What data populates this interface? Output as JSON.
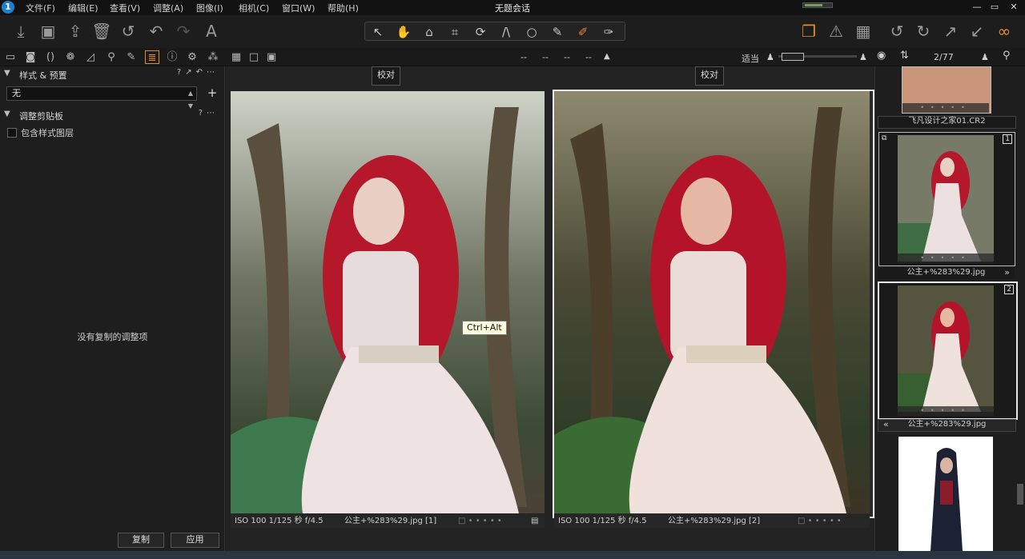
{
  "window": {
    "title": "无题会话",
    "logo": "1",
    "menu": [
      "文件(F)",
      "编辑(E)",
      "查看(V)",
      "调整(A)",
      "图像(I)",
      "相机(C)",
      "窗口(W)",
      "帮助(H)"
    ],
    "controls": [
      "—",
      "▭",
      "✕"
    ]
  },
  "toolbar": {
    "left_icons": [
      "import-icon",
      "camera-icon",
      "export-icon",
      "trash-icon",
      "undo-all-icon",
      "undo-icon",
      "redo-icon",
      "text-icon"
    ],
    "cursor_tools": [
      "select-icon",
      "pan-icon",
      "loupe-icon",
      "crop-icon",
      "rotate-icon",
      "keystone-icon",
      "circle-icon",
      "brush-icon",
      "erase-icon",
      "pick-icon"
    ],
    "right_icons": [
      "layers-icon",
      "warning-icon",
      "grid-icon",
      "rotate-left-icon",
      "rotate-right-icon",
      "arrow-up-right-icon",
      "arrow-down-left-icon",
      "glasses-icon"
    ],
    "accent": "#e38b2c"
  },
  "tabs": {
    "items": [
      "folder-icon",
      "camera-tab-icon",
      "lens-icon",
      "color-icon",
      "exposure-icon",
      "search-tab-icon",
      "brush-tab-icon",
      "adjustments-tab-icon",
      "info-icon",
      "settings-icon",
      "batch-icon"
    ],
    "active_index": 7,
    "view_modes": [
      "multi-view-icon",
      "single-view-icon",
      "compare-view-icon"
    ],
    "readouts": [
      "--",
      "--",
      "--",
      "--"
    ],
    "fit_label": "适当",
    "zoom_position": 0.05,
    "counter": "2/77"
  },
  "left_panel": {
    "styles_title": "样式 & 预置",
    "styles_value": "无",
    "clipboard_title": "调整剪贴板",
    "include_layers": "包含样式图层",
    "empty_message": "没有复制的调整项",
    "copy_btn": "复制",
    "apply_btn": "应用"
  },
  "viewer": {
    "left_label": "校对",
    "right_label": "校对",
    "left_info": "ISO 100  1/125 秒  f/4.5",
    "left_file": "公主+%283%29.jpg [1]",
    "right_info": "ISO 100  1/125 秒  f/4.5",
    "right_file": "公主+%283%29.jpg [2]",
    "tooltip": "Ctrl+Alt"
  },
  "browser": {
    "top_name": "飞凡设计之家01.CR2",
    "item1_name": "公主+%283%29.jpg",
    "item1_badge": "1",
    "item2_name": "公主+%283%29.jpg",
    "item2_badge": "2"
  }
}
